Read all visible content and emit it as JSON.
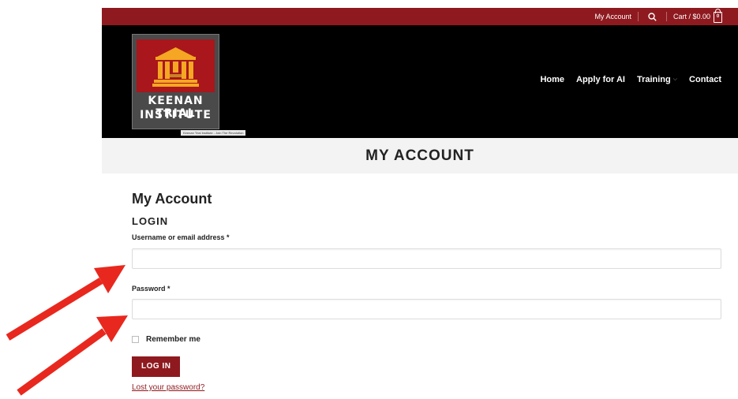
{
  "topbar": {
    "my_account": "My Account",
    "search_icon": "search-icon",
    "cart_label": "Cart / $0.00",
    "cart_count": "0",
    "background": "#8e1a1f"
  },
  "logo": {
    "line1": "KEENAN TRIAL",
    "line2": "INSTITUTE",
    "tagline": "Keenan Trial Institute - Join The Revolution",
    "icon": "courthouse-icon",
    "primary_color": "#a9161b",
    "accent_color": "#f5a623"
  },
  "nav": {
    "items": [
      {
        "label": "Home"
      },
      {
        "label": "Apply for AI"
      },
      {
        "label": "Training",
        "has_dropdown": true
      },
      {
        "label": "Contact"
      }
    ]
  },
  "page": {
    "title": "MY ACCOUNT"
  },
  "account": {
    "heading": "My Account",
    "login_heading": "LOGIN",
    "username_label": "Username or email address *",
    "username_value": "",
    "password_label": "Password *",
    "password_value": "",
    "remember_label": "Remember me",
    "remember_checked": false,
    "login_button": "LOG IN",
    "lost_password": "Lost your password?"
  },
  "annotations": {
    "arrow_color": "#e8281e",
    "arrow_count": 2
  }
}
